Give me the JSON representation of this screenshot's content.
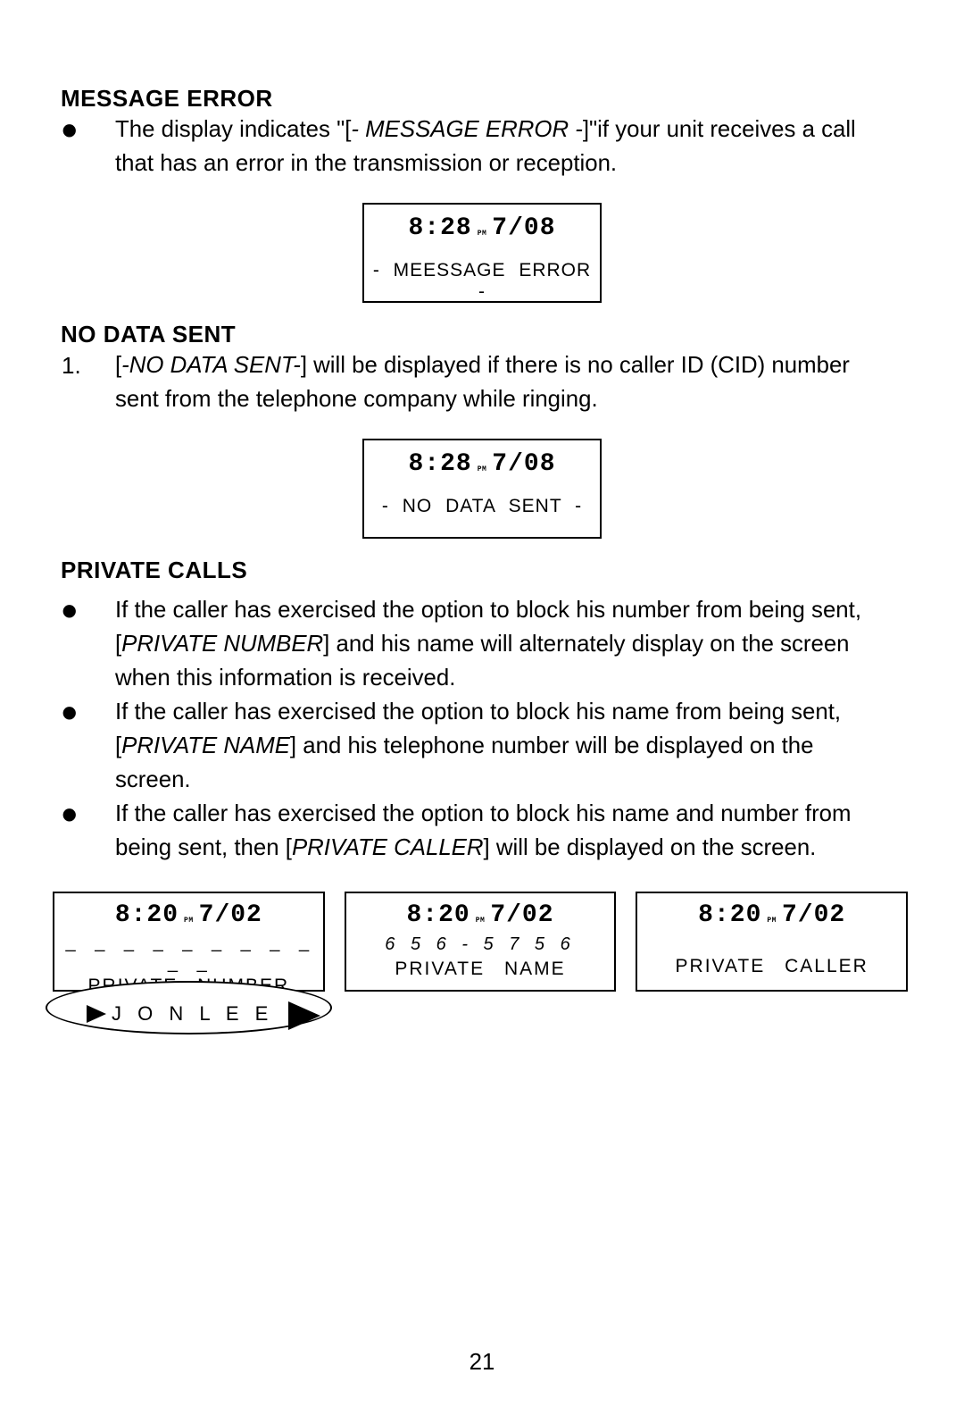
{
  "sections": {
    "messageError": {
      "heading": "MESSAGE ERROR",
      "bullet1_pre": "The display indicates \"[",
      "bullet1_it": "- MESSAGE ERROR -",
      "bullet1_post": "]\"if your unit receives a call that has an error in the transmission or reception.",
      "display": {
        "time": "8:28",
        "pm": "PM",
        "date": "7/08",
        "msg": "- MEESSAGE  ERROR -"
      }
    },
    "noDataSent": {
      "heading": "NO DATA SENT",
      "num": "1.",
      "item1_pre": "[",
      "item1_it": "-NO DATA SENT-",
      "item1_post": "] will be displayed if there is no caller ID (CID) number sent from the telephone company while ringing.",
      "display": {
        "time": "8:28",
        "pm": "PM",
        "date": "7/08",
        "msg": "- NO  DATA SENT -"
      }
    },
    "privateCalls": {
      "heading": "PRIVATE CALLS",
      "b1_pre": "If the caller has exercised the option to block his number from being sent, [",
      "b1_it": "PRIVATE NUMBER",
      "b1_post": "] and his name will alternately display on the screen when this information is received.",
      "b2_pre": "If the caller has exercised the option to block his name from being sent, [",
      "b2_it": "PRIVATE NAME",
      "b2_post": "] and his telephone number will be displayed on the screen.",
      "b3_pre": "If the caller has exercised the option to block his name and number from being sent, then [",
      "b3_it": "PRIVATE CALLER",
      "b3_post": "] will be displayed on the screen.",
      "displays": {
        "left": {
          "time": "8:20",
          "pm": "PM",
          "date": "7/02",
          "dashes": "_ _ _ _ _ _  _ _ _ _ _",
          "msg": "PRIVATE   NUMBER",
          "altName": "J O N  L E E"
        },
        "mid": {
          "time": "8:20",
          "pm": "PM",
          "date": "7/02",
          "phone": "6 5 6 - 5 7 5 6",
          "msg": "PRIVATE   NAME"
        },
        "right": {
          "time": "8:20",
          "pm": "PM",
          "date": "7/02",
          "msg": "PRIVATE   CALLER"
        }
      }
    }
  },
  "pageNumber": "21"
}
